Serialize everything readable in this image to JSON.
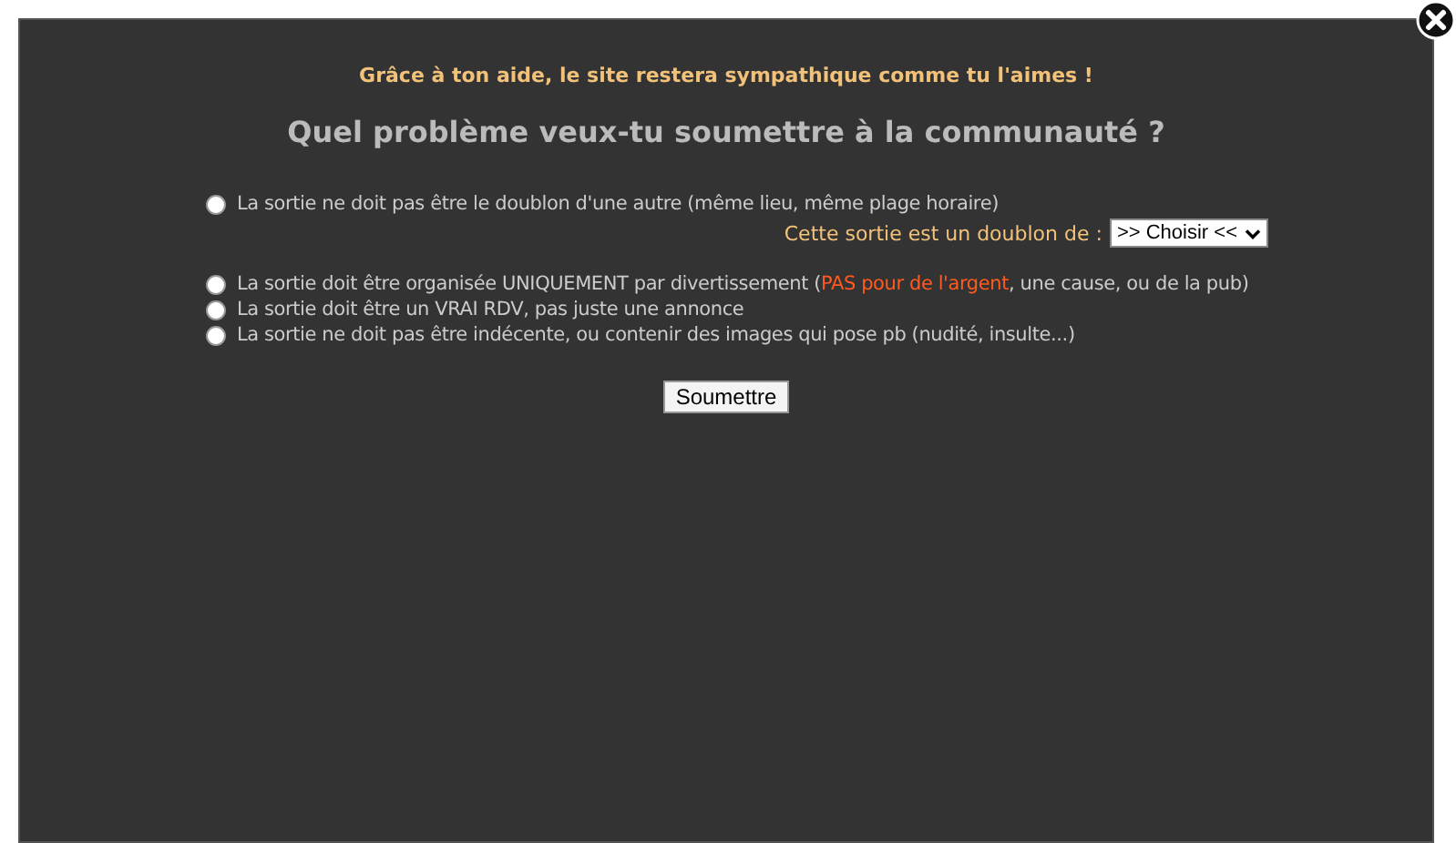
{
  "dialog": {
    "subtitle": "Grâce à ton aide, le site restera sympathique comme tu l'aimes !",
    "title": "Quel problème veux-tu soumettre à la communauté ?",
    "options": [
      {
        "selected": false,
        "parts": [
          {
            "kind": "plain",
            "text": "La sortie ne doit pas être le doublon d'une autre (même lieu, même plage horaire)"
          }
        ],
        "duplicate": {
          "label": "Cette sortie est un doublon de :",
          "value": ">> Choisir <<"
        }
      },
      {
        "selected": false,
        "parts": [
          {
            "kind": "plain",
            "text": "La sortie doit être organisée UNIQUEMENT par divertissement ("
          },
          {
            "kind": "warning",
            "text": "PAS pour de l'argent"
          },
          {
            "kind": "plain",
            "text": ", une cause, ou de la pub)"
          }
        ]
      },
      {
        "selected": false,
        "parts": [
          {
            "kind": "plain",
            "text": "La sortie doit être un VRAI RDV, pas juste une annonce"
          }
        ]
      },
      {
        "selected": false,
        "parts": [
          {
            "kind": "plain",
            "text": "La sortie ne doit pas être indécente, ou contenir des images qui pose pb (nudité, insulte...)"
          }
        ]
      }
    ],
    "submit": "Soumettre"
  }
}
